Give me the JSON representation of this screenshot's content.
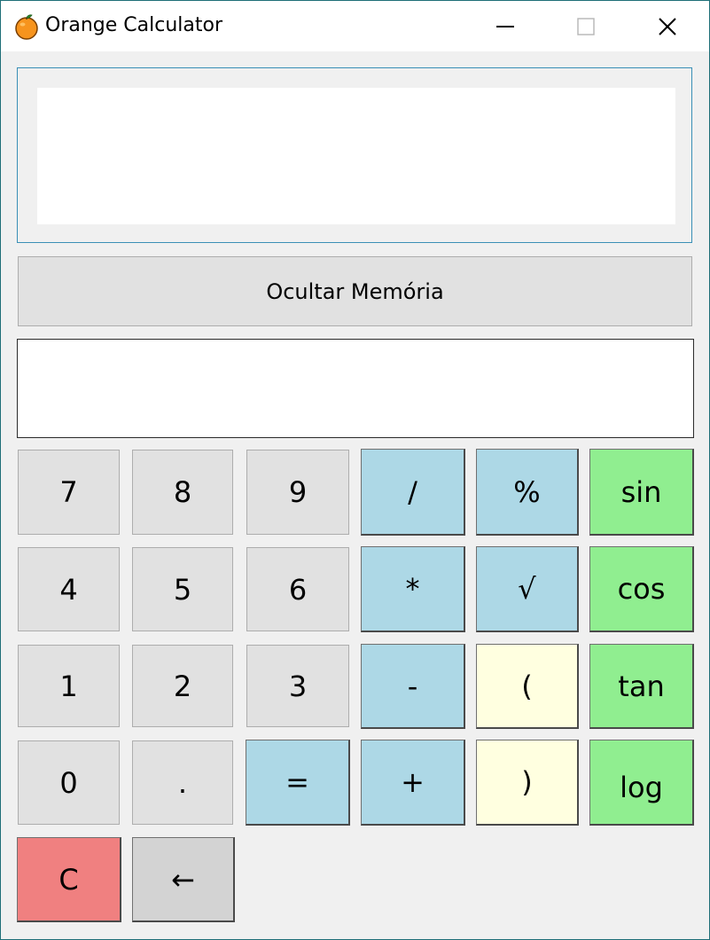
{
  "window": {
    "title": "Orange Calculator",
    "icon": "orange-fruit-icon",
    "controls": {
      "minimize_icon": "minimize-icon",
      "maximize_icon": "maximize-icon",
      "close_icon": "close-icon"
    }
  },
  "display": {
    "value": ""
  },
  "memory": {
    "toggle_label": "Ocultar Memória",
    "content": ""
  },
  "keypad": {
    "row1": {
      "k1": "7",
      "k2": "8",
      "k3": "9",
      "k4": "/",
      "k5": "%",
      "k6": "sin"
    },
    "row2": {
      "k1": "4",
      "k2": "5",
      "k3": "6",
      "k4": "*",
      "k5": "√",
      "k6": "cos"
    },
    "row3": {
      "k1": "1",
      "k2": "2",
      "k3": "3",
      "k4": "-",
      "k5": "(",
      "k6": "tan"
    },
    "row4": {
      "k1": "0",
      "k2": ".",
      "k3": "=",
      "k4": "+",
      "k5": ")",
      "k6": "log"
    },
    "row5": {
      "k1": "C",
      "k2": "←"
    }
  },
  "colors": {
    "number_key": "#e1e1e1",
    "operator_key": "#add8e6",
    "paren_key": "#ffffe0",
    "function_key": "#90ee90",
    "clear_key": "#f08080",
    "backspace_key": "#d3d3d3",
    "window_border": "#1e6e77"
  }
}
